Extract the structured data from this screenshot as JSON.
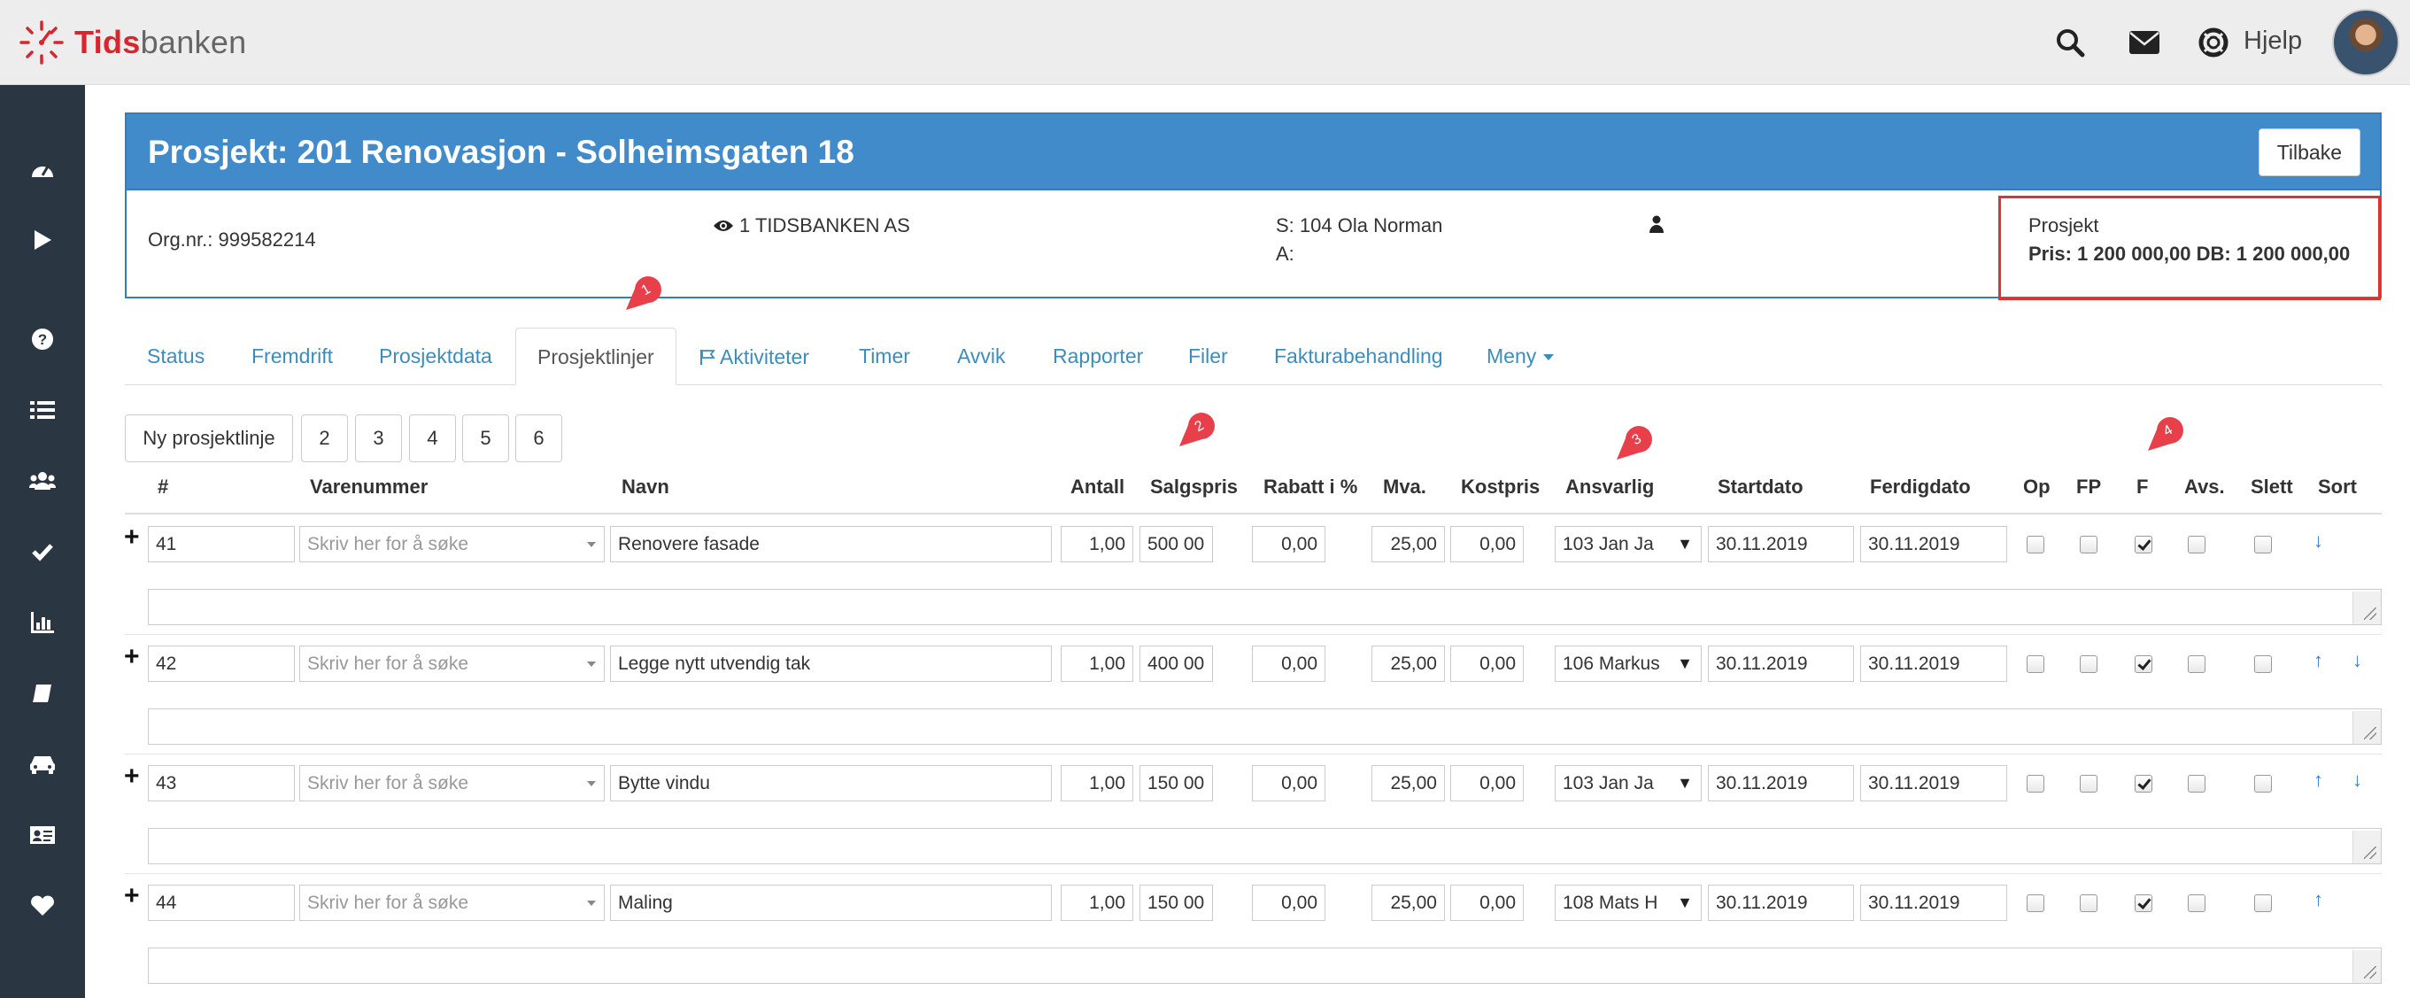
{
  "app": {
    "brand_a": "Tids",
    "brand_b": "banken"
  },
  "topbar": {
    "help_label": "Hjelp"
  },
  "project": {
    "title": "Prosjekt: 201 Renovasjon - Solheimsgaten 18",
    "back_button": "Tilbake",
    "org_nr": "Org.nr.: 999582214",
    "company": "1 TIDSBANKEN AS",
    "s_label": "S: 104 Ola Norman",
    "a_label": "A:",
    "summary_title": "Prosjekt",
    "summary_price": "Pris: 1 200 000,00 DB: 1 200 000,00"
  },
  "tabs": [
    "Status",
    "Fremdrift",
    "Prosjektdata",
    "Prosjektlinjer",
    "Aktiviteter",
    "Timer",
    "Avvik",
    "Rapporter",
    "Filer",
    "Fakturabehandling",
    "Meny"
  ],
  "toolbar": {
    "new_line": "Ny prosjektlinje",
    "pages": [
      "2",
      "3",
      "4",
      "5",
      "6"
    ]
  },
  "columns": [
    "#",
    "Varenummer",
    "Navn",
    "Antall",
    "Salgspris",
    "Rabatt i %",
    "Mva.",
    "Kostpris",
    "Ansvarlig",
    "Startdato",
    "Ferdigdato",
    "Op",
    "FP",
    "F",
    "Avs.",
    "Slett",
    "Sort"
  ],
  "search_placeholder": "Skriv her for å søke",
  "rows": [
    {
      "nr": "41",
      "navn": "Renovere fasade",
      "antall": "1,00",
      "salgspris": "500 00",
      "rabatt": "0,00",
      "mva": "25,00",
      "kostpris": "0,00",
      "ansvarlig": "103 Jan Ja",
      "start": "30.11.2019",
      "ferdig": "30.11.2019"
    },
    {
      "nr": "42",
      "navn": "Legge nytt utvendig tak",
      "antall": "1,00",
      "salgspris": "400 00",
      "rabatt": "0,00",
      "mva": "25,00",
      "kostpris": "0,00",
      "ansvarlig": "106 Markus",
      "start": "30.11.2019",
      "ferdig": "30.11.2019"
    },
    {
      "nr": "43",
      "navn": "Bytte vindu",
      "antall": "1,00",
      "salgspris": "150 00",
      "rabatt": "0,00",
      "mva": "25,00",
      "kostpris": "0,00",
      "ansvarlig": "103 Jan Ja",
      "start": "30.11.2019",
      "ferdig": "30.11.2019"
    },
    {
      "nr": "44",
      "navn": "Maling",
      "antall": "1,00",
      "salgspris": "150 00",
      "rabatt": "0,00",
      "mva": "25,00",
      "kostpris": "0,00",
      "ansvarlig": "108 Mats H",
      "start": "30.11.2019",
      "ferdig": "30.11.2019"
    }
  ],
  "row_state": [
    {
      "f_checked": true,
      "sort": [
        "down"
      ]
    },
    {
      "f_checked": true,
      "sort": [
        "up",
        "down"
      ]
    },
    {
      "f_checked": true,
      "sort": [
        "up",
        "down"
      ]
    },
    {
      "f_checked": true,
      "sort": [
        "up"
      ]
    }
  ],
  "annotations": [
    "1",
    "2",
    "3",
    "4"
  ],
  "colors": {
    "header_blue": "#428bca",
    "sidebar": "#2b3643",
    "link": "#3c8dbc",
    "brand_red": "#d7262d",
    "pin_red": "#e8404a",
    "highlight": "#dd3333"
  }
}
